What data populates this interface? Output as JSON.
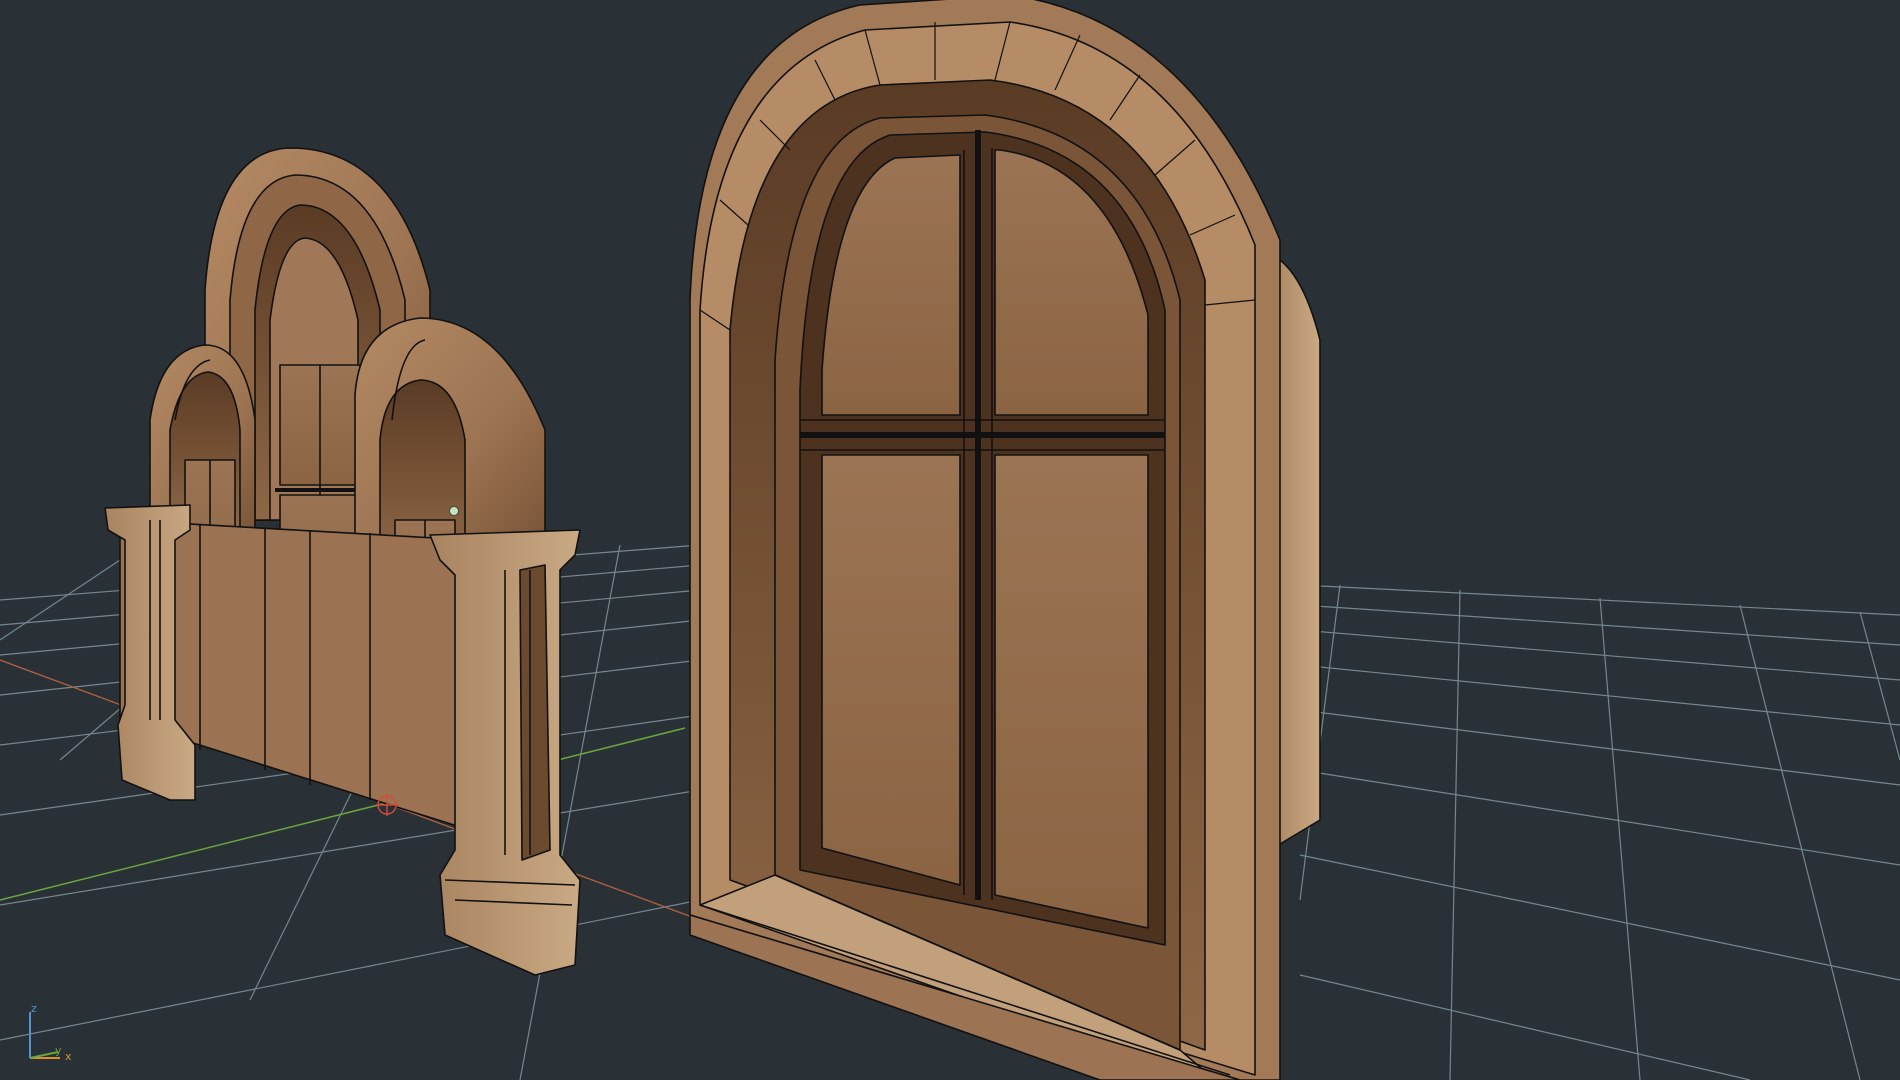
{
  "viewport": {
    "background_color": "#2a3136",
    "grid_color": "#8da3ad",
    "x_axis_color": "#b4613d",
    "y_axis_color": "#6aa63f",
    "z_axis_color": "#4f95d2",
    "model_color": "#a57a57",
    "model_shadow_color": "#4c3120",
    "wire_color": "#111111"
  },
  "scene": {
    "objects": [
      {
        "name": "arched-facade-model",
        "icon": "arched-facade"
      },
      {
        "name": "arched-window-model",
        "icon": "arched-window"
      }
    ],
    "pivot_icon": "pivot-crosshair-icon",
    "vertex_marker_icon": "selected-vertex-icon"
  },
  "axis_gizmo": {
    "z_label": "z",
    "y_label": "y",
    "x_label": "x"
  }
}
